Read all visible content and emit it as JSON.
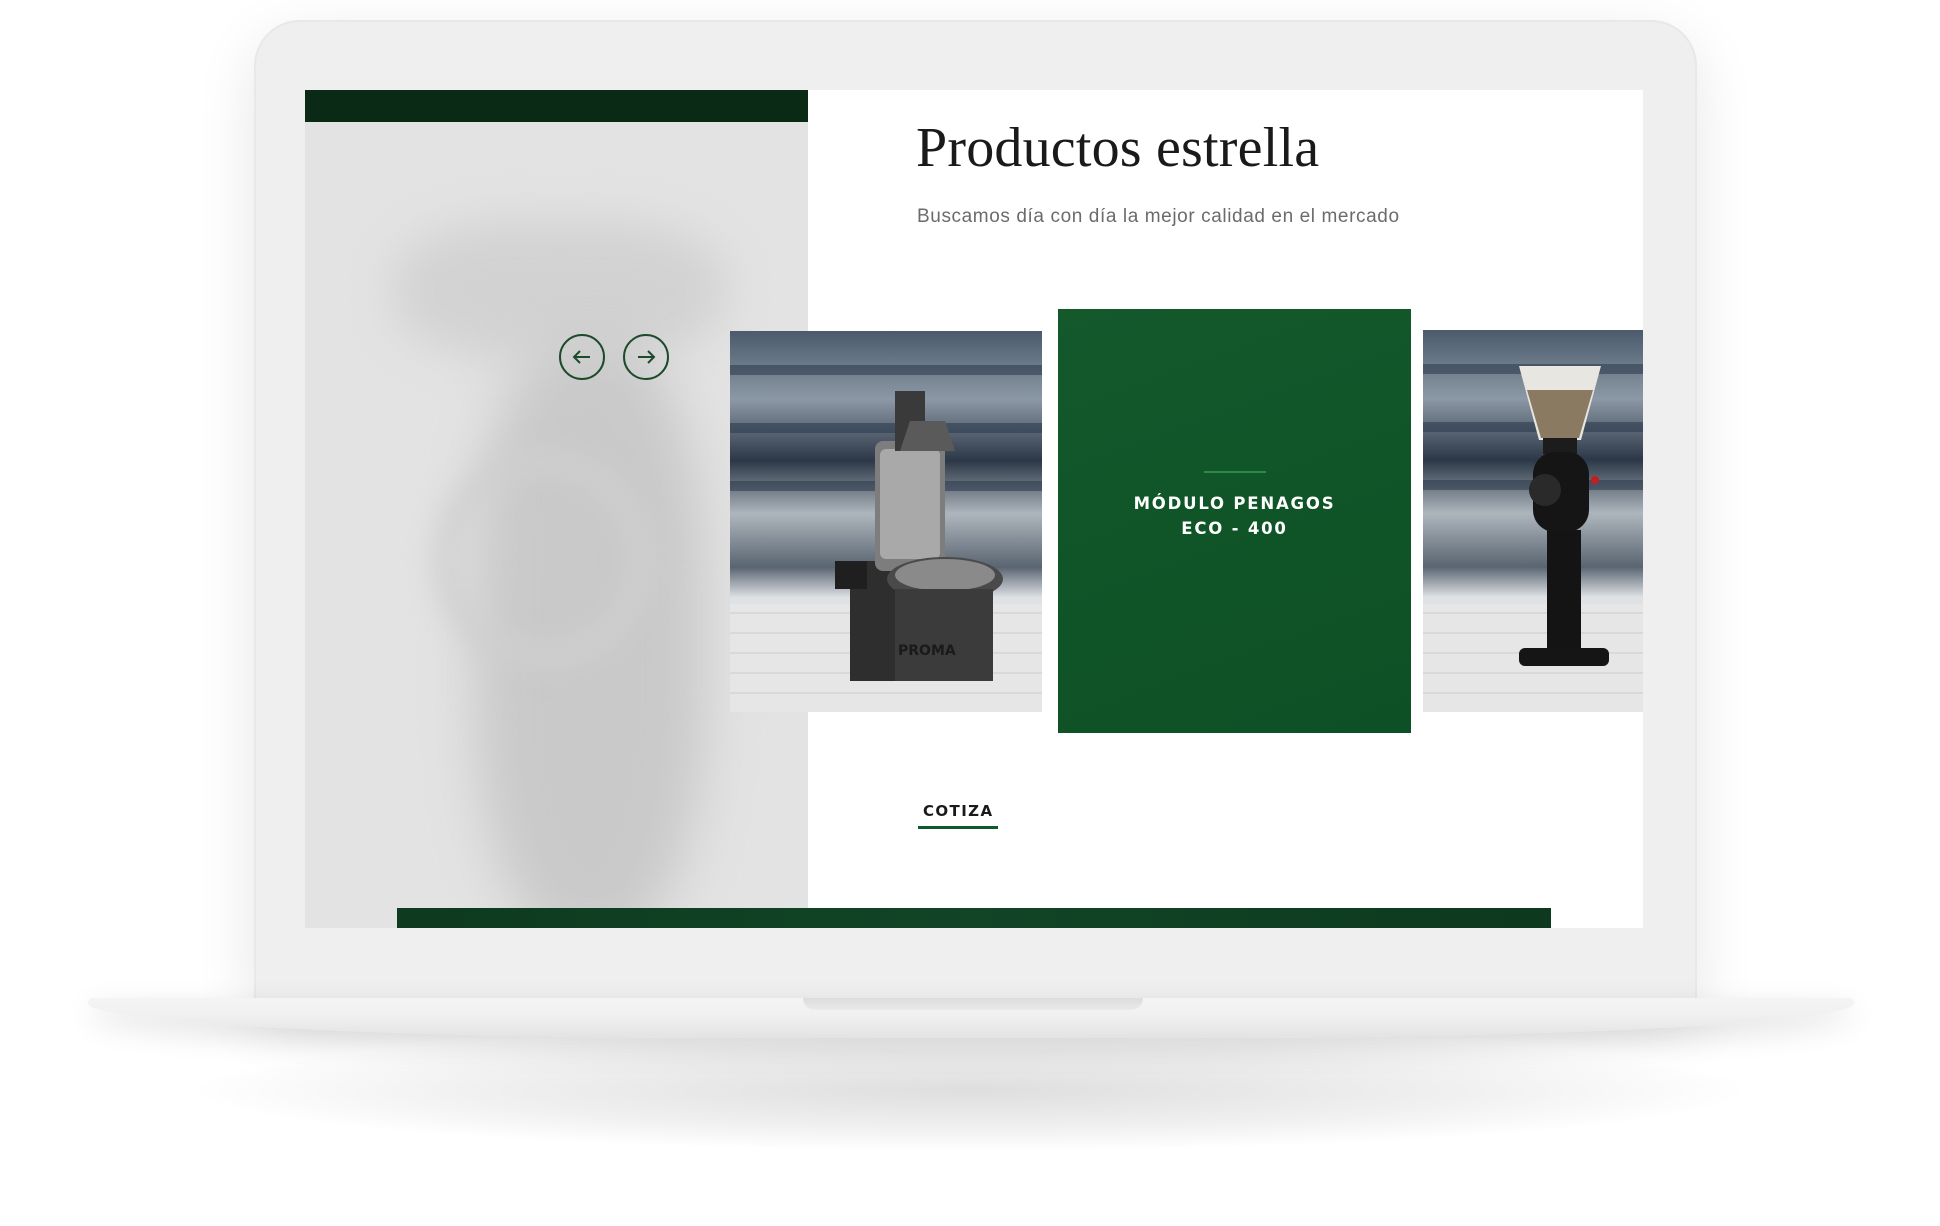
{
  "section": {
    "title": "Productos estrella",
    "subtitle": "Buscamos día con día la mejor calidad en el mercado"
  },
  "carousel": {
    "active_product": {
      "line1": "MÓDULO PENAGOS",
      "line2": "ECO - 400"
    },
    "products": [
      {
        "kind": "coffee-roaster",
        "brand_mark": "PROMA"
      },
      {
        "kind": "penagos-module"
      },
      {
        "kind": "coffee-grinder"
      }
    ]
  },
  "cta": {
    "label": "COTIZA"
  },
  "colors": {
    "brand_green": "#0f5428",
    "dark_green": "#0b2a16",
    "title_text": "#1a1a1a",
    "subtitle_text": "#6b6b6b"
  },
  "icons": {
    "prev": "arrow-left-icon",
    "next": "arrow-right-icon"
  }
}
